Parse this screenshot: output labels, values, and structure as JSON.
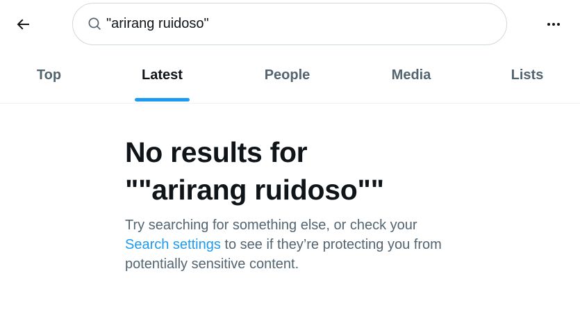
{
  "header": {
    "back_icon": "arrow-left-icon",
    "search": {
      "icon": "search-icon",
      "value": "\"arirang ruidoso\"",
      "placeholder": "Search"
    },
    "more_icon": "more-horizontal-icon"
  },
  "tabs": [
    {
      "label": "Top",
      "active": false
    },
    {
      "label": "Latest",
      "active": true
    },
    {
      "label": "People",
      "active": false
    },
    {
      "label": "Media",
      "active": false
    },
    {
      "label": "Lists",
      "active": false
    }
  ],
  "empty_state": {
    "title_line1": "No results for",
    "title_line2": "\"\"arirang ruidoso\"\"",
    "desc_before_link": "Try searching for something else, or check your ",
    "link_text": "Search settings",
    "desc_after_link": " to see if they’re protecting you from potentially sensitive content."
  },
  "colors": {
    "accent": "#1d9bf0",
    "text_primary": "#0f1419",
    "text_secondary": "#536471",
    "border": "#cfd9de"
  }
}
